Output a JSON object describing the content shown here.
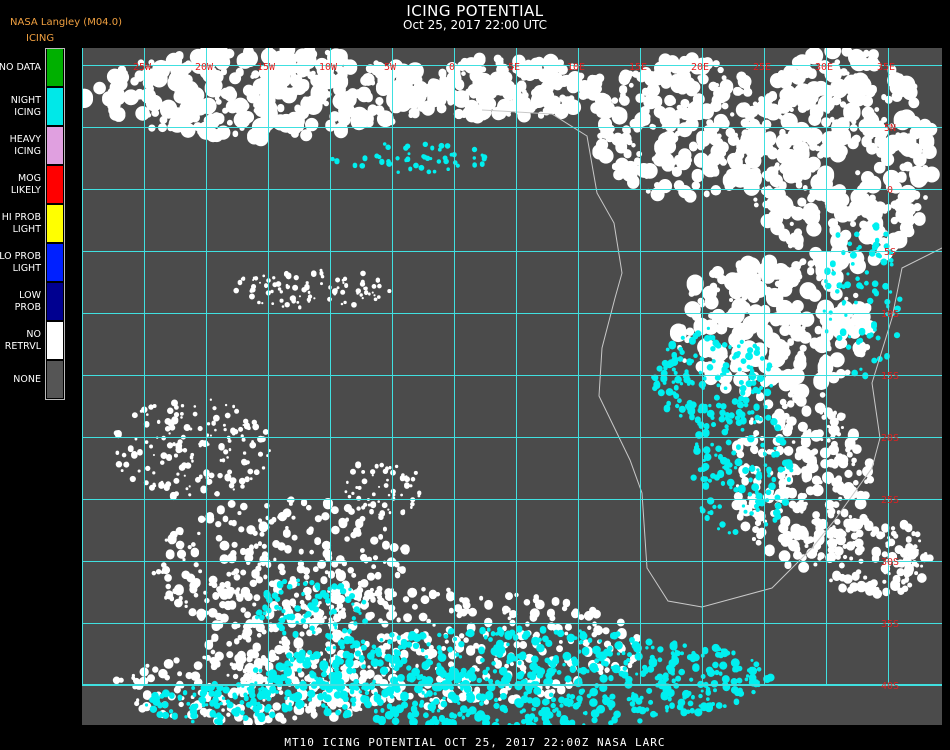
{
  "header": {
    "title": "ICING POTENTIAL",
    "subtitle": "Oct 25, 2017 22:00 UTC"
  },
  "brand": "NASA Langley (M04.0)",
  "legend": {
    "title": "ICING",
    "items": [
      {
        "label_lines": [
          "NO DATA"
        ],
        "color": "#00b000"
      },
      {
        "label_lines": [
          "NIGHT",
          "ICING"
        ],
        "color": "#00e8e8"
      },
      {
        "label_lines": [
          "HEAVY",
          "ICING"
        ],
        "color": "#e0a0e0"
      },
      {
        "label_lines": [
          "MOG",
          "LIKELY"
        ],
        "color": "#ff0000"
      },
      {
        "label_lines": [
          "HI PROB",
          "LIGHT"
        ],
        "color": "#ffff00"
      },
      {
        "label_lines": [
          "LO PROB",
          "LIGHT"
        ],
        "color": "#0020ff"
      },
      {
        "label_lines": [
          "LOW",
          "PROB"
        ],
        "color": "#000090"
      },
      {
        "label_lines": [
          "NO",
          "RETRVL"
        ],
        "color": "#ffffff"
      },
      {
        "label_lines": [
          "NONE"
        ],
        "color": "#555555"
      }
    ]
  },
  "map": {
    "colors": {
      "background": "#4b4b4b",
      "grid": "#40e0e0",
      "coast": "#c8c8c8",
      "labels": "#e02020",
      "cloud": "#ffffff",
      "icing": "#00f0f0"
    },
    "lon_labels": [
      "25W",
      "20W",
      "15W",
      "10W",
      "5W",
      "0",
      "5E",
      "10E",
      "15E",
      "20E",
      "25E",
      "30E",
      "35E"
    ],
    "lat_labels": [
      "5N",
      "0",
      "5S",
      "10S",
      "15S",
      "20S",
      "25S",
      "30S",
      "35S",
      "40S"
    ]
  },
  "footer": "MT10  ICING POTENTIAL   OCT 25, 2017 22:00Z   NASA LARC"
}
